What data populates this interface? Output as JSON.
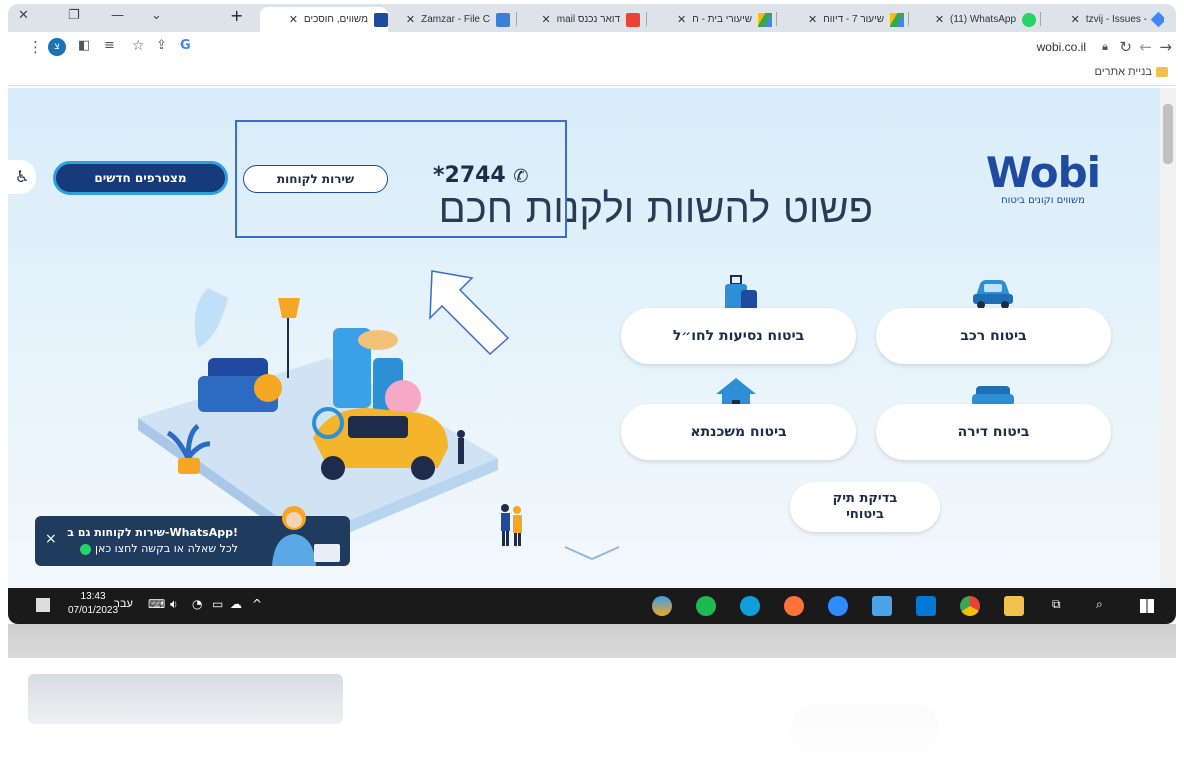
{
  "browser": {
    "tabs": [
      {
        "title": "משווים, חוסכים",
        "active": true
      },
      {
        "title": "Zamzar - File C",
        "active": false
      },
      {
        "title": "דואר נכנס mail",
        "active": false
      },
      {
        "title": "שיעורי בית - ח",
        "active": false
      },
      {
        "title": "שיעור 7 - דיווח",
        "active": false
      },
      {
        "title": "(11) WhatsApp",
        "active": false
      },
      {
        "title": "tzvij - Issues -",
        "active": false
      }
    ],
    "new_tab": "+",
    "url": "wobi.co.il",
    "bookmark": "בניית אתרים",
    "profile_initial": "צ"
  },
  "page": {
    "logo": "Wobi",
    "logo_tagline": "משווים וקונים ביטוח",
    "headline": "פשוט להשוות ולקנות חכם",
    "phone": "*2744",
    "customer_service": "שירות לקוחות",
    "new_members": "מצטרפים חדשים",
    "accessibility_icon": "wheelchair-icon",
    "insurance": {
      "car": "ביטוח רכב",
      "travel": "ביטוח נסיעות לחו״ל",
      "apartment": "ביטוח דירה",
      "mortgage": "ביטוח משכנתא",
      "check_line1": "בדיקת תיק",
      "check_line2": "ביטוחי"
    },
    "whatsapp_banner": {
      "line1": "!WhatsApp-שירות לקוחות גם ב",
      "line2": "לכל שאלה או בקשה לחצו כאן",
      "close": "×"
    }
  },
  "taskbar": {
    "time": "13:43",
    "date": "07/01/2023",
    "lang": "עבר"
  },
  "colors": {
    "brand_blue": "#1f4aa0",
    "navy": "#173b7a",
    "highlight": "#3c6bd0"
  }
}
